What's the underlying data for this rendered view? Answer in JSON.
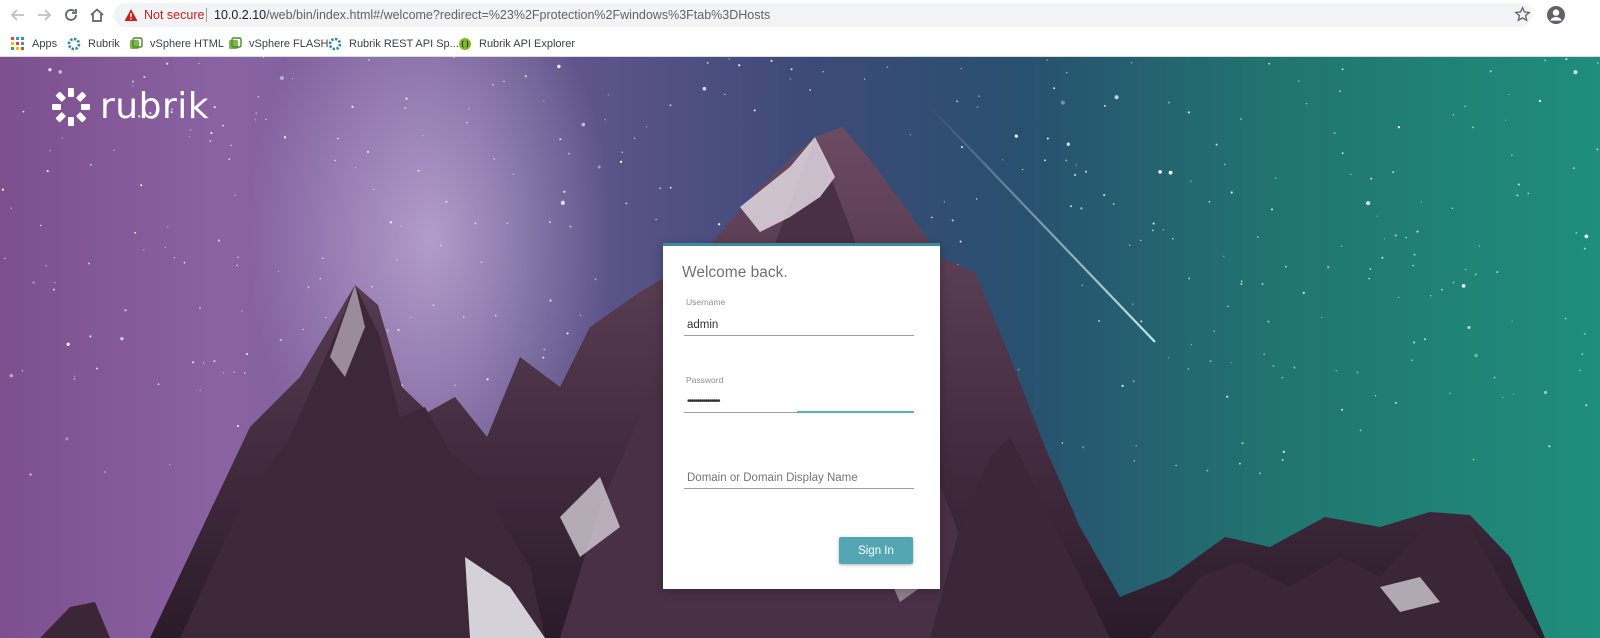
{
  "browser": {
    "security_label": "Not secure",
    "url_host": "10.0.2.10",
    "url_path": "/web/bin/index.html#/welcome?redirect=%23%2Fprotection%2Fwindows%3Ftab%3DHosts",
    "bookmarks": [
      {
        "label": "Apps",
        "icon": "apps-grid-icon"
      },
      {
        "label": "Rubrik",
        "icon": "rubrik-favicon-icon"
      },
      {
        "label": "vSphere HTML",
        "icon": "vsphere-icon"
      },
      {
        "label": "vSphere FLASH",
        "icon": "vsphere-icon"
      },
      {
        "label": "Rubrik REST API Sp...",
        "icon": "rubrik-favicon-icon"
      },
      {
        "label": "Rubrik API Explorer",
        "icon": "swagger-icon"
      }
    ]
  },
  "brand": {
    "name": "rubrik"
  },
  "login": {
    "title": "Welcome back.",
    "username_label": "Username",
    "username_value": "admin",
    "password_label": "Password",
    "password_value": "••••••••••••••••",
    "domain_placeholder": "Domain or Domain Display Name",
    "signin_label": "Sign In"
  },
  "colors": {
    "accent": "#53a6b2",
    "card_top_border": "#3d8a9a",
    "warning": "#c5221f"
  }
}
